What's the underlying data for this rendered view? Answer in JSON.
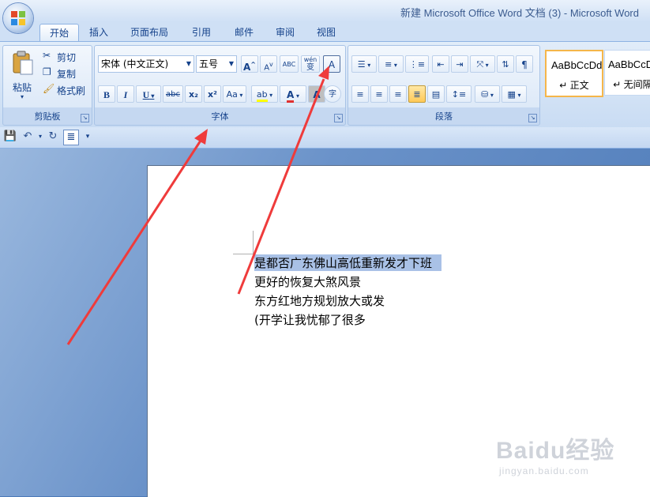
{
  "window": {
    "title": "新建 Microsoft Office Word 文档 (3) - Microsoft Word"
  },
  "tabs": [
    {
      "label": "开始",
      "active": true
    },
    {
      "label": "插入"
    },
    {
      "label": "页面布局"
    },
    {
      "label": "引用"
    },
    {
      "label": "邮件"
    },
    {
      "label": "审阅"
    },
    {
      "label": "视图"
    }
  ],
  "clipboard": {
    "group_label": "剪贴板",
    "paste": "粘贴",
    "cut": "剪切",
    "copy": "复制",
    "format_painter": "格式刷"
  },
  "font": {
    "group_label": "字体",
    "font_name": "宋体 (中文正文)",
    "font_size": "五号",
    "grow": "A",
    "shrink": "A",
    "clear_format": "ABC",
    "phonetic": "wén",
    "phonetic_char": "变",
    "char_border": "A",
    "bold": "B",
    "italic": "I",
    "underline": "U",
    "strike": "abc",
    "subscript": "x₂",
    "superscript": "x²",
    "change_case": "Aa",
    "highlight": "ab",
    "font_color": "A",
    "char_shading": "A",
    "enclose": "字"
  },
  "paragraph": {
    "group_label": "段落"
  },
  "styles": [
    {
      "sample": "AaBbCcDd",
      "name": "↵ 正文"
    },
    {
      "sample": "AaBbCcDd",
      "name": "↵ 无间隔"
    }
  ],
  "document": {
    "lines": [
      "是都否广东佛山高低重新发才下班",
      "更好的恢复大煞风景",
      "东方红地方规划放大或发",
      "(开学让我忧郁了很多"
    ]
  },
  "watermark": {
    "main": "Baidu经验",
    "sub": "jingyan.baidu.com"
  },
  "colors": {
    "accent": "#15428b",
    "arrow": "#ef3b3b",
    "highlight": "#a9c1e6",
    "font_color_bar": "#e03030",
    "highlight_bar": "#ffff00"
  }
}
